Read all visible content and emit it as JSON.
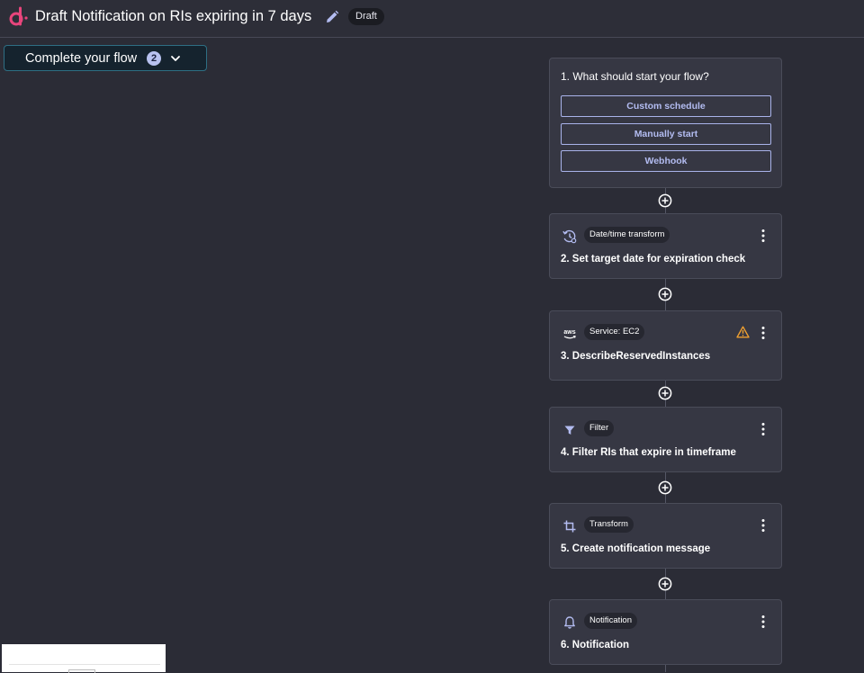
{
  "header": {
    "title": "Draft Notification on RIs expiring in 7 days",
    "status_badge": "Draft"
  },
  "toolbar": {
    "complete_flow_label": "Complete your flow",
    "complete_flow_count": "2"
  },
  "trigger": {
    "title": "1. What should start your flow?",
    "options": [
      "Custom schedule",
      "Manually start",
      "Webhook"
    ]
  },
  "steps": [
    {
      "tag": "Date/time transform",
      "title": "2. Set target date for expiration check",
      "icon": "datetime-transform-icon"
    },
    {
      "tag": "Service: EC2",
      "title": "3. DescribeReservedInstances",
      "icon": "aws-icon",
      "warning": true
    },
    {
      "tag": "Filter",
      "title": "4. Filter RIs that expire in timeframe",
      "icon": "filter-icon"
    },
    {
      "tag": "Transform",
      "title": "5. Create notification message",
      "icon": "crop-transform-icon"
    },
    {
      "tag": "Notification",
      "title": "6. Notification",
      "icon": "bell-icon"
    }
  ],
  "colors": {
    "background": "#2b2c36",
    "card": "#363743",
    "accent": "#b3bcf1",
    "brand": "#e8457c",
    "warning": "#f0a030"
  }
}
